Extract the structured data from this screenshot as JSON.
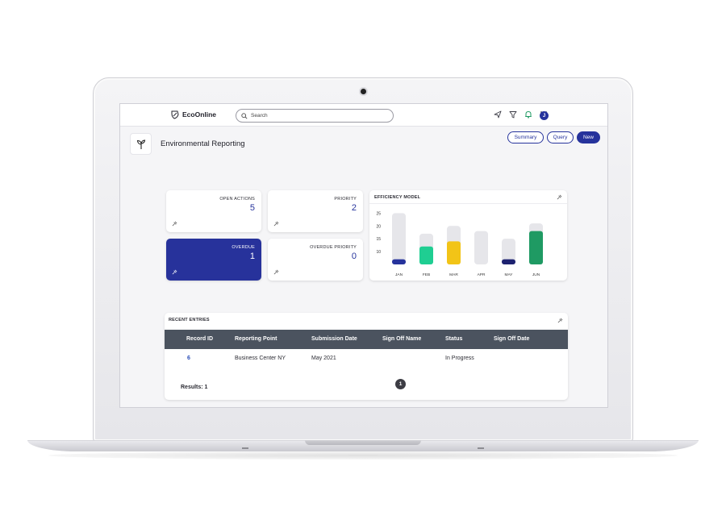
{
  "app": {
    "brand": "EcoOnline",
    "avatar_initial": "J"
  },
  "search": {
    "placeholder": "Search"
  },
  "toolbar_icons": [
    "send-icon",
    "filter-icon",
    "bell-icon",
    "apps-grid-icon"
  ],
  "header": {
    "title": "Environmental Reporting",
    "buttons": {
      "summary": "Summary",
      "query": "Query",
      "new": "New"
    }
  },
  "kpis": [
    {
      "label": "OPEN ACTIONS",
      "value": "5"
    },
    {
      "label": "PRIORITY",
      "value": "2"
    },
    {
      "label": "OVERDUE",
      "value": "1"
    },
    {
      "label": "OVERDUE PRIORITY",
      "value": "0"
    }
  ],
  "chart": {
    "title": "EFFICIENCY MODEL"
  },
  "chart_data": {
    "type": "bar",
    "title": "EFFICIENCY MODEL",
    "categories": [
      "JAN",
      "FEB",
      "MAR",
      "APR",
      "MAY",
      "JUN"
    ],
    "series": [
      {
        "values": [
          25,
          17,
          20,
          18,
          15,
          21
        ]
      },
      {
        "values": [
          7,
          12,
          14,
          5,
          7,
          18
        ]
      }
    ],
    "colors": [
      "#26339c",
      "#1fce92",
      "#f2c417",
      "#b8242a",
      "#1d2270",
      "#1f9a63"
    ],
    "background_color": "#e6e6ea",
    "yticks": [
      10,
      15,
      20,
      25
    ],
    "ylim": [
      5,
      27
    ],
    "grid": false
  },
  "table": {
    "title": "RECENT ENTRIES",
    "columns": [
      "Record ID",
      "Reporting Point",
      "Submission Date",
      "Sign Off Name",
      "Status",
      "Sign Off Date"
    ],
    "rows": [
      {
        "record_id": "6",
        "reporting_point": "Business Center NY",
        "submission_date": "May 2021",
        "sign_off_name": "",
        "status": "In Progress",
        "sign_off_date": ""
      }
    ],
    "page": "1",
    "results": "Results: 1"
  },
  "colors": {
    "accent": "#26339c",
    "table_header": "#4b535f"
  }
}
